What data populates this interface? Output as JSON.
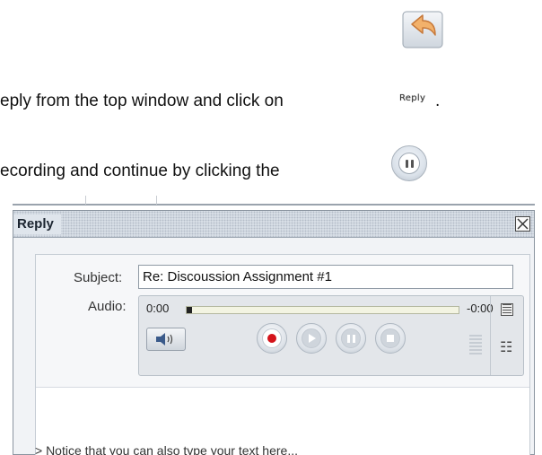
{
  "instructions": {
    "line1_text": "eply from the top window and click on",
    "line1_button_label": "Reply",
    "line1_end": ".",
    "line2_text": "ecording and continue by clicking the"
  },
  "icons": {
    "reply_hint": "reply-arrow-icon",
    "pause_hint": "pause-icon"
  },
  "dialog": {
    "title": "Reply",
    "close_icon": "close-icon",
    "subject_label": "Subject:",
    "subject_value": "Re: Discoussion Assignment #1",
    "audio_label": "Audio:",
    "audio": {
      "time_elapsed": "0:00",
      "time_remaining": "-0:00",
      "progress_fraction": 0.02,
      "record_color": "#d4141b"
    },
    "body_text": "> Notice that you can also type your text here..."
  },
  "colors": {
    "accent_record": "#d4141b",
    "titlebar": "#dfe5ec"
  }
}
